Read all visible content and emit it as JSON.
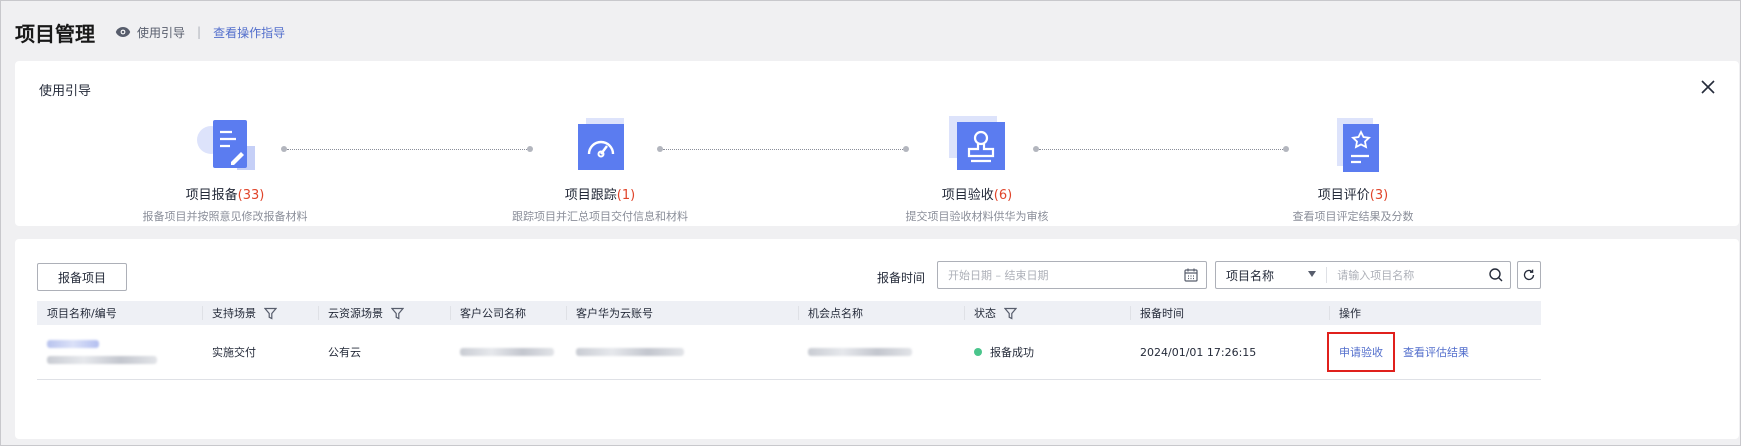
{
  "header": {
    "title": "项目管理",
    "guide_toggle": "使用引导",
    "separator": "|",
    "help_link": "查看操作指导"
  },
  "guide": {
    "title": "使用引导",
    "steps": [
      {
        "name": "项目报备",
        "count": "(33)",
        "desc": "报备项目并按照意见修改报备材料",
        "icon": "document-edit-icon"
      },
      {
        "name": "项目跟踪",
        "count": "(1)",
        "desc": "跟踪项目并汇总项目交付信息和材料",
        "icon": "gauge-icon"
      },
      {
        "name": "项目验收",
        "count": "(6)",
        "desc": "提交项目验收材料供华为审核",
        "icon": "stamp-icon"
      },
      {
        "name": "项目评价",
        "count": "(3)",
        "desc": "查看项目评定结果及分数",
        "icon": "star-document-icon"
      }
    ]
  },
  "toolbar": {
    "add_button": "报备项目",
    "time_label": "报备时间",
    "date_placeholder": "开始日期 – 结束日期",
    "search_field": "项目名称",
    "search_placeholder": "请输入项目名称"
  },
  "table": {
    "columns": [
      "项目名称/编号",
      "支持场景",
      "云资源场景",
      "客户公司名称",
      "客户华为云账号",
      "机会点名称",
      "状态",
      "报备时间",
      "操作"
    ],
    "rows": [
      {
        "scenario": "实施交付",
        "cloud_scenario": "公有云",
        "status": "报备成功",
        "time": "2024/01/01 17:26:15",
        "actions": [
          "申请验收",
          "查看评估结果"
        ]
      }
    ]
  },
  "colors": {
    "accent": "#526ecc",
    "count_red": "#e0452b",
    "status_green": "#4ac58c",
    "highlight_red": "#e0201c",
    "icon_blue": "#5b7cf0"
  }
}
